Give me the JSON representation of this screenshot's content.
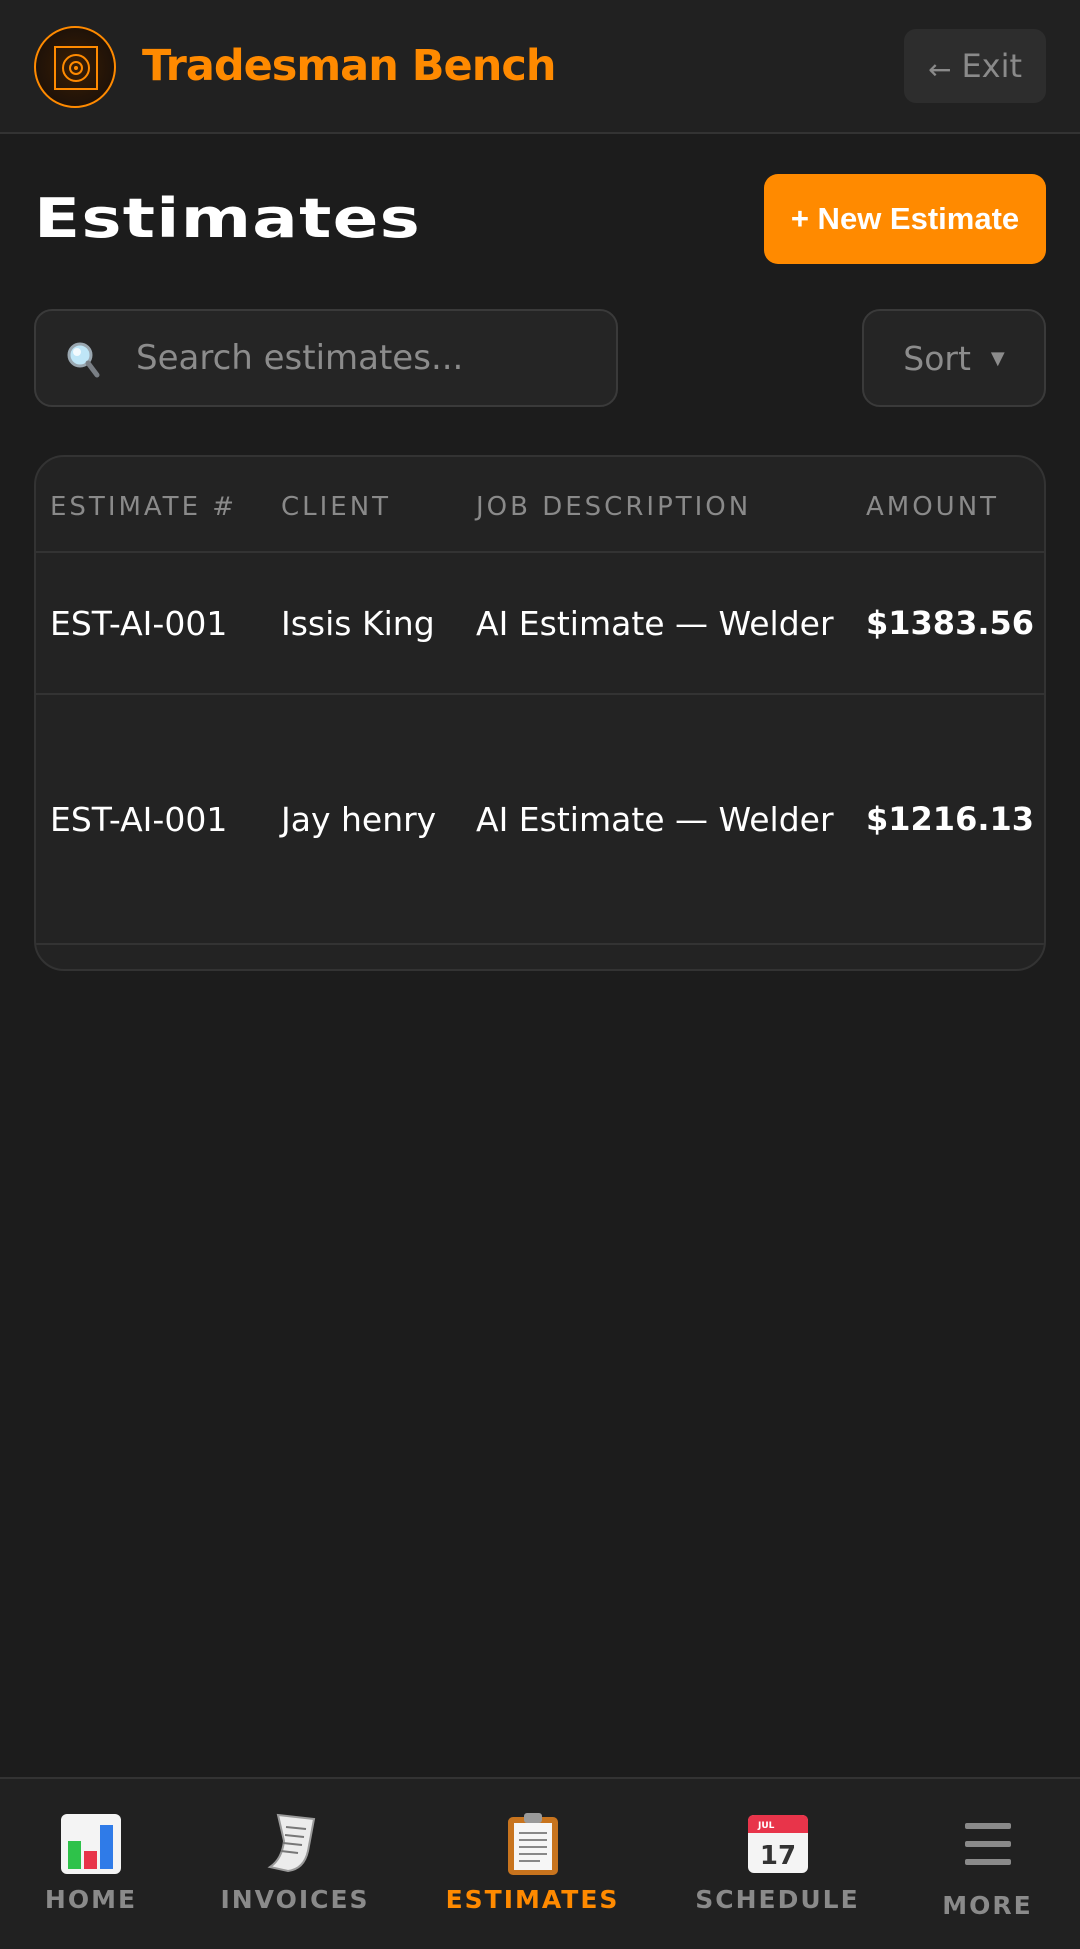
{
  "app": {
    "brand": "Tradesman Bench",
    "exit_label": "Exit",
    "accent_color": "#ff8a00"
  },
  "page": {
    "title": "Estimates",
    "new_button_label": "+ New Estimate",
    "search_placeholder": "Search estimates...",
    "sort_label": "Sort"
  },
  "table": {
    "headers": [
      "ESTIMATE #",
      "CLIENT",
      "JOB DESCRIPTION",
      "AMOUNT"
    ],
    "rows": [
      {
        "estimate": "EST-AI-001",
        "client": "Issis King",
        "description": "AI Estimate — Welder",
        "amount": "$1383.56"
      },
      {
        "estimate": "EST-AI-001",
        "client": "Jay henry",
        "description": "AI Estimate — Welder",
        "amount": "$1216.13"
      }
    ]
  },
  "nav": {
    "items": [
      {
        "label": "HOME",
        "icon": "bar-chart-icon"
      },
      {
        "label": "INVOICES",
        "icon": "receipt-icon"
      },
      {
        "label": "ESTIMATES",
        "icon": "clipboard-icon",
        "active": true
      },
      {
        "label": "SCHEDULE",
        "icon": "calendar-icon",
        "calendar_month": "JUL",
        "calendar_day": "17"
      },
      {
        "label": "MORE",
        "icon": "hamburger-menu-icon"
      }
    ]
  }
}
